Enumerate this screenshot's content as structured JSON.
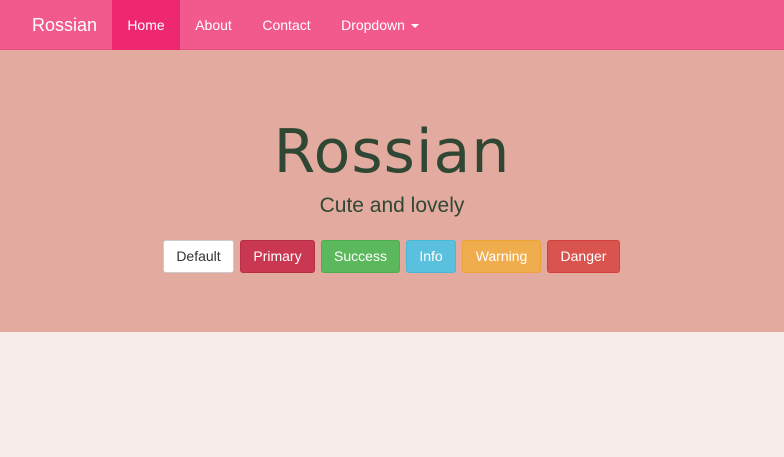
{
  "navbar": {
    "brand": "Rossian",
    "items": [
      {
        "label": "Home"
      },
      {
        "label": "About"
      },
      {
        "label": "Contact"
      },
      {
        "label": "Dropdown"
      }
    ]
  },
  "hero": {
    "title": "Rossian",
    "subtitle": "Cute and lovely"
  },
  "buttons": {
    "default": "Default",
    "primary": "Primary",
    "success": "Success",
    "info": "Info",
    "warning": "Warning",
    "danger": "Danger"
  },
  "colors": {
    "navbar": "#f25a8e",
    "nav_active": "#ee2870",
    "jumbotron": "#e3aaa0",
    "page_background": "#f8ecea",
    "heading_text": "#2f4733"
  }
}
